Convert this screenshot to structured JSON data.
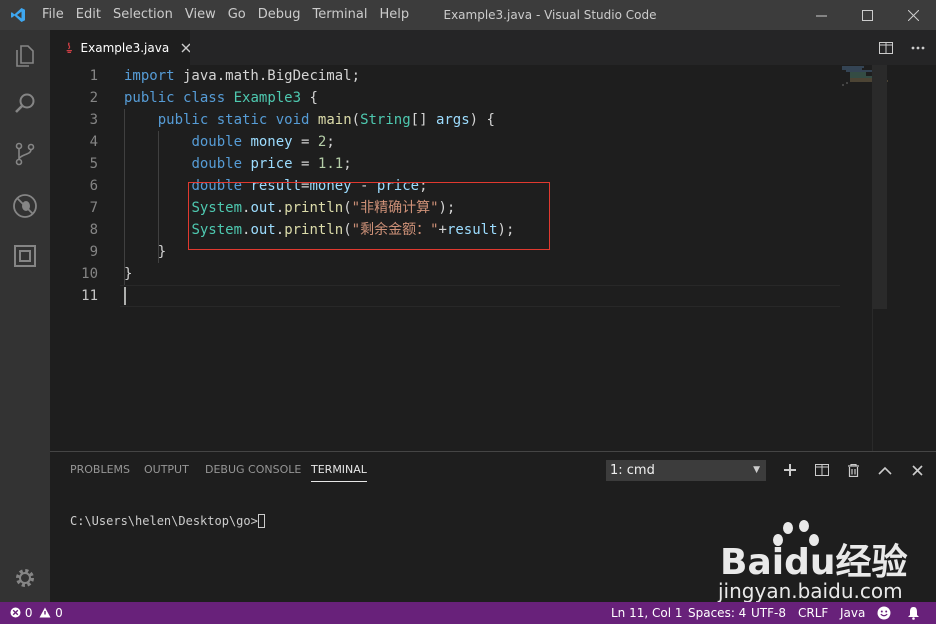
{
  "window": {
    "title": "Example3.java - Visual Studio Code",
    "menu": [
      "File",
      "Edit",
      "Selection",
      "View",
      "Go",
      "Debug",
      "Terminal",
      "Help"
    ]
  },
  "activity_bar": {
    "items": [
      "explorer-icon",
      "search-icon",
      "source-control-icon",
      "debug-icon",
      "extensions-icon"
    ],
    "bottom": "settings-gear-icon"
  },
  "tabs": [
    {
      "label": "Example3.java",
      "active": true,
      "icon": "java-file-icon"
    }
  ],
  "editor": {
    "line_numbers": [
      "1",
      "2",
      "3",
      "4",
      "5",
      "6",
      "7",
      "8",
      "9",
      "10",
      "11"
    ],
    "current_line": "11",
    "lines": [
      [
        {
          "t": "import",
          "c": "k"
        },
        {
          "t": " java.math.BigDecimal;",
          "c": "p"
        }
      ],
      [
        {
          "t": "public",
          "c": "k"
        },
        {
          "t": " ",
          "c": "p"
        },
        {
          "t": "class",
          "c": "k"
        },
        {
          "t": " ",
          "c": "p"
        },
        {
          "t": "Example3",
          "c": "t"
        },
        {
          "t": " {",
          "c": "p"
        }
      ],
      [
        {
          "t": "    ",
          "c": "p"
        },
        {
          "t": "public",
          "c": "k"
        },
        {
          "t": " ",
          "c": "p"
        },
        {
          "t": "static",
          "c": "k"
        },
        {
          "t": " ",
          "c": "p"
        },
        {
          "t": "void",
          "c": "k"
        },
        {
          "t": " ",
          "c": "p"
        },
        {
          "t": "main",
          "c": "f"
        },
        {
          "t": "(",
          "c": "p"
        },
        {
          "t": "String",
          "c": "t"
        },
        {
          "t": "[] ",
          "c": "p"
        },
        {
          "t": "args",
          "c": "v"
        },
        {
          "t": ") {",
          "c": "p"
        }
      ],
      [
        {
          "t": "        ",
          "c": "p"
        },
        {
          "t": "double",
          "c": "k"
        },
        {
          "t": " ",
          "c": "p"
        },
        {
          "t": "money",
          "c": "v"
        },
        {
          "t": " = ",
          "c": "p"
        },
        {
          "t": "2",
          "c": "n"
        },
        {
          "t": ";",
          "c": "p"
        }
      ],
      [
        {
          "t": "        ",
          "c": "p"
        },
        {
          "t": "double",
          "c": "k"
        },
        {
          "t": " ",
          "c": "p"
        },
        {
          "t": "price",
          "c": "v"
        },
        {
          "t": " = ",
          "c": "p"
        },
        {
          "t": "1.1",
          "c": "n"
        },
        {
          "t": ";",
          "c": "p"
        }
      ],
      [
        {
          "t": "        ",
          "c": "p"
        },
        {
          "t": "double",
          "c": "k"
        },
        {
          "t": " ",
          "c": "p"
        },
        {
          "t": "result",
          "c": "v"
        },
        {
          "t": "=",
          "c": "p"
        },
        {
          "t": "money",
          "c": "v"
        },
        {
          "t": " - ",
          "c": "p"
        },
        {
          "t": "price",
          "c": "v"
        },
        {
          "t": ";",
          "c": "p"
        }
      ],
      [
        {
          "t": "        ",
          "c": "p"
        },
        {
          "t": "System",
          "c": "t"
        },
        {
          "t": ".",
          "c": "p"
        },
        {
          "t": "out",
          "c": "v"
        },
        {
          "t": ".",
          "c": "p"
        },
        {
          "t": "println",
          "c": "f"
        },
        {
          "t": "(",
          "c": "p"
        },
        {
          "t": "\"非精确计算\"",
          "c": "s"
        },
        {
          "t": ");",
          "c": "p"
        }
      ],
      [
        {
          "t": "        ",
          "c": "p"
        },
        {
          "t": "System",
          "c": "t"
        },
        {
          "t": ".",
          "c": "p"
        },
        {
          "t": "out",
          "c": "v"
        },
        {
          "t": ".",
          "c": "p"
        },
        {
          "t": "println",
          "c": "f"
        },
        {
          "t": "(",
          "c": "p"
        },
        {
          "t": "\"剩余金额：\"",
          "c": "s"
        },
        {
          "t": "+",
          "c": "p"
        },
        {
          "t": "result",
          "c": "v"
        },
        {
          "t": ");",
          "c": "p"
        }
      ],
      [
        {
          "t": "    }",
          "c": "p"
        }
      ],
      [
        {
          "t": "}",
          "c": "p"
        }
      ],
      []
    ]
  },
  "panel": {
    "tabs": [
      "PROBLEMS",
      "OUTPUT",
      "DEBUG CONSOLE",
      "TERMINAL"
    ],
    "active_tab": "TERMINAL",
    "terminal_select": "1: cmd",
    "actions": [
      "add-terminal-icon",
      "split-terminal-icon",
      "kill-terminal-icon",
      "maximize-panel-icon",
      "close-panel-icon"
    ],
    "terminal_prompt": "C:\\Users\\helen\\Desktop\\go>"
  },
  "status_bar": {
    "errors": "0",
    "warnings": "0",
    "position": "Ln 11, Col 1",
    "spaces": "Spaces: 4",
    "encoding": "UTF-8",
    "eol": "CRLF",
    "language": "Java"
  },
  "watermark": {
    "brand": "Baidu经验",
    "url": "jingyan.baidu.com"
  },
  "colors": {
    "statusbar": "#68217a",
    "highlight_box": "#e0392f",
    "keyword": "#569cd6",
    "type": "#4ec9b0",
    "string": "#ce9178"
  }
}
